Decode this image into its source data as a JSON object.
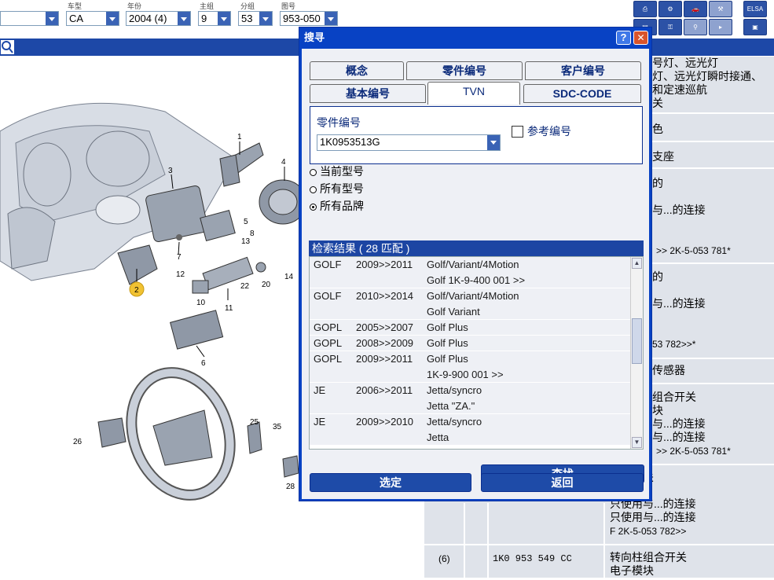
{
  "filters": {
    "labels": {
      "model": "车型",
      "year": "年份",
      "main_group": "主组",
      "sub_group": "分组",
      "diagram": "图号"
    },
    "values": {
      "first": "",
      "model": "CA",
      "year": "2004 (4)",
      "main_group": "9",
      "sub_group": "53",
      "diagram": "953-050"
    }
  },
  "toolbar": {
    "elsa_label": "ELSA"
  },
  "diagram": {
    "callouts": [
      "1",
      "2",
      "3",
      "4",
      "5",
      "6",
      "7",
      "8",
      "10",
      "11",
      "12",
      "13",
      "14",
      "20",
      "22",
      "25",
      "26",
      "28",
      "35"
    ],
    "highlighted": "2"
  },
  "right_panel": {
    "rows": [
      {
        "lines": [
          "号灯、远光灯",
          "灯、远光灯瞬时接通、",
          "和定速巡航",
          "关"
        ]
      },
      {
        "lines": [
          "色"
        ]
      },
      {
        "lines": [
          "支座"
        ]
      },
      {
        "lines": [
          "的"
        ]
      },
      {
        "lines": [
          "与...的连接"
        ]
      },
      {
        "lines": [
          ">> 2K-5-053 781*"
        ]
      },
      {
        "lines": [
          "的"
        ]
      },
      {
        "lines": [
          "与...的连接"
        ]
      },
      {
        "lines": [
          "53 782>>*"
        ]
      },
      {
        "lines": [
          "传感器"
        ]
      },
      {
        "lines": [
          "组合开关",
          "块",
          "与...的连接",
          "与...的连接"
        ]
      },
      {
        "lines": [
          ">> 2K-5-053 781*"
        ]
      },
      {
        "lines": [
          "组合开关",
          "块",
          "只使用与...的连接",
          "只使用与...的连接"
        ]
      },
      {
        "lines": [
          "F 2K-5-053 782>>"
        ]
      }
    ],
    "last_row": {
      "pos": "(6)",
      "part_no": "1K0  953  549  CC",
      "desc": [
        "转向柱组合开关",
        "电子模块"
      ]
    }
  },
  "dialog": {
    "title": "搜寻",
    "help_label": "?",
    "close_label": "✕",
    "tabs": [
      "概念",
      "零件编号",
      "客户编号",
      "基本编号",
      "TVN",
      "SDC-CODE"
    ],
    "active_tab": "TVN",
    "part_label": "零件编号",
    "part_value": "1K0953513G",
    "ref_checkbox_label": "参考编号",
    "radios": [
      {
        "label": "当前型号",
        "checked": false
      },
      {
        "label": "所有型号",
        "checked": false
      },
      {
        "label": "所有品牌",
        "checked": true
      }
    ],
    "results_title": "检索结果",
    "results_count": "( 28 匹配 )",
    "results": [
      {
        "model": "GOLF",
        "years": "2009>>2011",
        "line1": "Golf/Variant/4Motion",
        "line2": "Golf 1K-9-400 001 >>"
      },
      {
        "model": "GOLF",
        "years": "2010>>2014",
        "line1": "Golf/Variant/4Motion",
        "line2": "Golf Variant"
      },
      {
        "model": "GOPL",
        "years": "2005>>2007",
        "line1": "Golf Plus",
        "line2": ""
      },
      {
        "model": "GOPL",
        "years": "2008>>2009",
        "line1": "Golf Plus",
        "line2": ""
      },
      {
        "model": "GOPL",
        "years": "2009>>2011",
        "line1": "Golf Plus",
        "line2": "1K-9-900 001 >>"
      },
      {
        "model": "JE",
        "years": "2006>>2011",
        "line1": "Jetta/syncro",
        "line2": "Jetta \"ZA.\""
      },
      {
        "model": "JE",
        "years": "2009>>2010",
        "line1": "Jetta/syncro",
        "line2": "Jetta"
      }
    ],
    "search_button": "查找",
    "select_button": "选定",
    "back_button": "返回"
  }
}
